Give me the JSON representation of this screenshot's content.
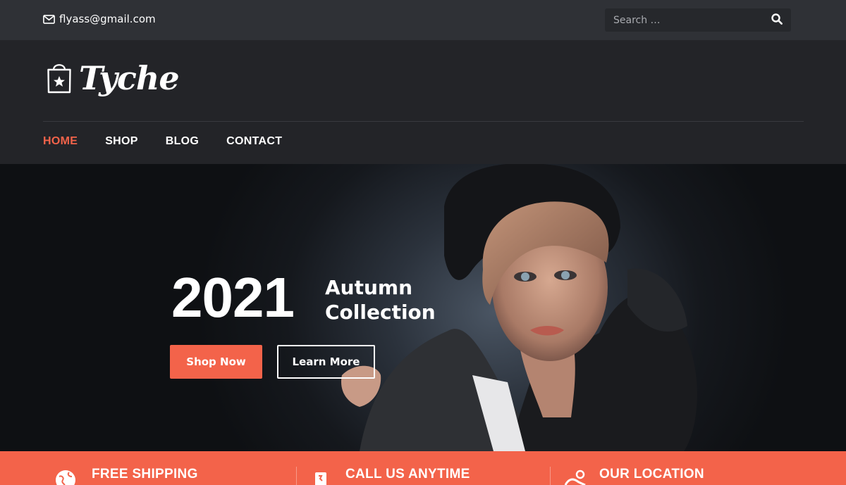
{
  "topbar": {
    "email": "flyass@gmail.com",
    "search_placeholder": "Search …"
  },
  "header": {
    "logo_text": "Tyche",
    "nav": [
      {
        "label": "HOME",
        "active": true
      },
      {
        "label": "SHOP",
        "active": false
      },
      {
        "label": "BLOG",
        "active": false
      },
      {
        "label": "CONTACT",
        "active": false
      }
    ]
  },
  "hero": {
    "year": "2021",
    "subtitle_line1": "Autumn",
    "subtitle_line2": "Collection",
    "primary_button": "Shop Now",
    "secondary_button": "Learn More"
  },
  "features": [
    {
      "title": "FREE SHIPPING",
      "icon": "globe-icon"
    },
    {
      "title": "CALL US ANYTIME",
      "icon": "phone-icon"
    },
    {
      "title": "OUR LOCATION",
      "icon": "location-icon"
    }
  ],
  "colors": {
    "accent": "#f3634a",
    "topbar_bg": "#2f3136",
    "header_bg": "#232428"
  }
}
